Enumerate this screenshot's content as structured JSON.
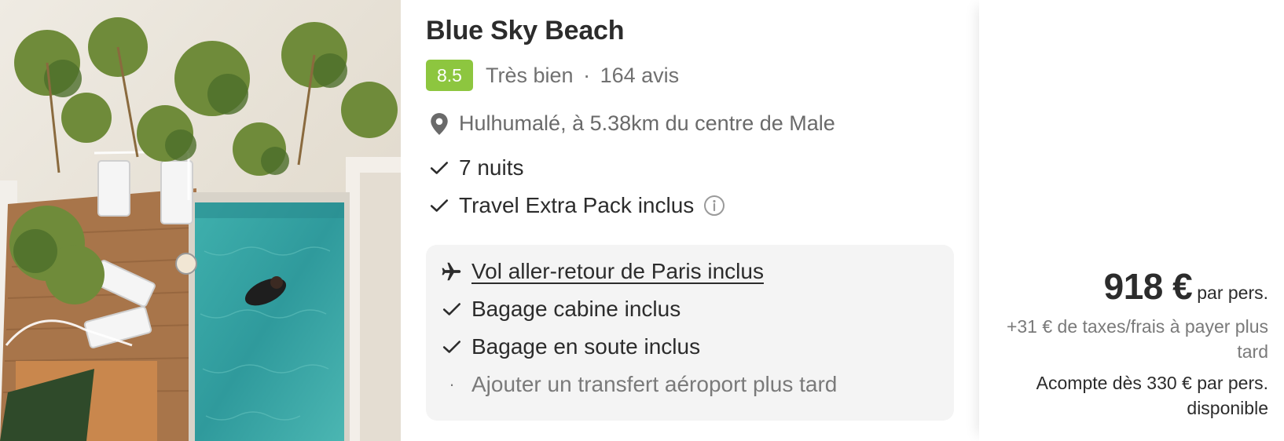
{
  "hotel": {
    "name": "Blue Sky Beach",
    "score": "8.5",
    "rating_label": "Très bien",
    "separator": "·",
    "reviews": "164 avis",
    "location": "Hulhumalé, à 5.38km du centre de Male"
  },
  "features": {
    "nights": "7 nuits",
    "pack": "Travel Extra Pack inclus"
  },
  "included": {
    "flight": "Vol aller-retour de Paris inclus",
    "cabin_bag": "Bagage cabine inclus",
    "hold_bag": "Bagage en soute inclus",
    "transfer": "Ajouter un transfert aéroport plus tard",
    "transfer_bullet": "·"
  },
  "pricing": {
    "price": "918 €",
    "per": "par pers.",
    "taxes": "+31 € de taxes/frais à payer plus tard",
    "deposit": "Acompte dès 330 € par pers. disponible"
  },
  "colors": {
    "score_bg": "#8dc63f",
    "pool": "#3aa3a5",
    "box_bg": "#f4f4f4"
  },
  "icons": [
    "location-pin-icon",
    "check-icon",
    "info-icon",
    "plane-icon"
  ]
}
